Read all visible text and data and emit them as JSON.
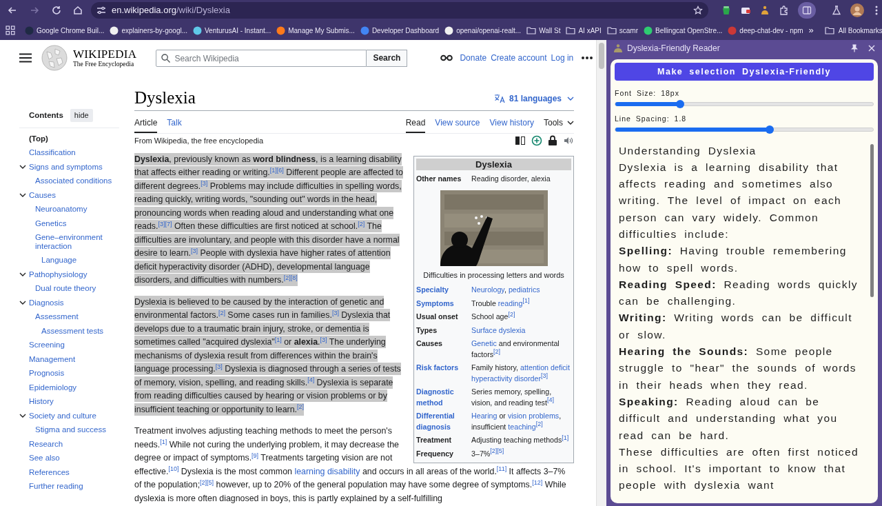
{
  "browser": {
    "address": {
      "host": "en.wikipedia.org",
      "path": "/wiki/Dyslexia"
    },
    "bookmarks": [
      {
        "label": "Google Chrome Buil...",
        "kind": "site",
        "color": "#1f2a44"
      },
      {
        "label": "explainers-by-googl...",
        "kind": "site",
        "color": "#f0f0f0"
      },
      {
        "label": "VenturusAI - Instant...",
        "kind": "site",
        "color": "#5fc8e8"
      },
      {
        "label": "Manage My Submis...",
        "kind": "site",
        "color": "#ff7a1a"
      },
      {
        "label": "Developer Dashboard",
        "kind": "site",
        "color": "#4285f4"
      },
      {
        "label": "openai/openai-realt...",
        "kind": "site",
        "color": "#f0f0f0"
      },
      {
        "label": "Wall St",
        "kind": "folder"
      },
      {
        "label": "AI xAPI",
        "kind": "folder"
      },
      {
        "label": "scamr",
        "kind": "folder"
      },
      {
        "label": "Bellingcat OpenStre...",
        "kind": "site",
        "color": "#2ecc71"
      },
      {
        "label": "deep-chat-dev - npm",
        "kind": "site",
        "color": "#cb3837"
      }
    ],
    "overflow": "»",
    "all_bookmarks": "All Bookmarks"
  },
  "wiki": {
    "logo": {
      "title": "WIKIPEDIA",
      "tagline": "The Free Encyclopedia"
    },
    "search": {
      "placeholder": "Search Wikipedia",
      "button": "Search"
    },
    "user_links": [
      "Donate",
      "Create account",
      "Log in"
    ],
    "toc": {
      "title": "Contents",
      "hide": "hide",
      "items": [
        {
          "label": "(Top)",
          "selected": true
        },
        {
          "label": "Classification",
          "selected": false
        },
        {
          "label": "Signs and symptoms",
          "selected": false,
          "expanded": true,
          "children": [
            {
              "label": "Associated conditions",
              "selected": false
            }
          ]
        },
        {
          "label": "Causes",
          "selected": false,
          "expanded": true,
          "children": [
            {
              "label": "Neuroanatomy",
              "selected": false
            },
            {
              "label": "Genetics",
              "selected": false
            },
            {
              "label": "Gene–environment interaction",
              "selected": false,
              "children": [
                {
                  "label": "Language",
                  "selected": false
                }
              ]
            }
          ]
        },
        {
          "label": "Pathophysiology",
          "selected": false,
          "expanded": true,
          "children": [
            {
              "label": "Dual route theory",
              "selected": false
            }
          ]
        },
        {
          "label": "Diagnosis",
          "selected": false,
          "expanded": true,
          "children": [
            {
              "label": "Assessment",
              "selected": false,
              "children": [
                {
                  "label": "Assessment tests",
                  "selected": false
                }
              ]
            }
          ]
        },
        {
          "label": "Screening",
          "selected": false
        },
        {
          "label": "Management",
          "selected": false
        },
        {
          "label": "Prognosis",
          "selected": false
        },
        {
          "label": "Epidemiology",
          "selected": false
        },
        {
          "label": "History",
          "selected": false
        },
        {
          "label": "Society and culture",
          "selected": false,
          "expanded": true,
          "children": [
            {
              "label": "Stigma and success",
              "selected": false
            }
          ]
        },
        {
          "label": "Research",
          "selected": false
        },
        {
          "label": "See also",
          "selected": false
        },
        {
          "label": "References",
          "selected": false
        },
        {
          "label": "Further reading",
          "selected": false
        }
      ]
    },
    "article": {
      "title": "Dyslexia",
      "languages": "81 languages",
      "tabs_left": [
        {
          "label": "Article",
          "selected": true
        },
        {
          "label": "Talk",
          "selected": false
        }
      ],
      "tabs_right": [
        {
          "label": "Read",
          "selected": true,
          "kind": "tab"
        },
        {
          "label": "View source",
          "selected": false,
          "kind": "tab"
        },
        {
          "label": "View history",
          "selected": false,
          "kind": "tab"
        },
        {
          "label": "Tools",
          "selected": false,
          "kind": "menu"
        }
      ],
      "tagline": "From Wikipedia, the free encyclopedia",
      "paragraphs": [
        {
          "selected": true,
          "segments": [
            {
              "text": "**Dyslexia**, previously known as **word blindness**, is a learning disability that affects either reading or writing.$^{[1][6]}$ Different people are affected to different degrees.$^{[3]}$ Problems may include difficulties in spelling words, reading quickly, writing words, \"sounding out\" words in the head, pronouncing words when reading aloud and understanding what one reads.$^{[3][7]}$ Often these difficulties are first noticed at school.$^{[2]}$ The difficulties are involuntary, and people with this disorder have a normal desire to learn.$^{[3]}$ People with dyslexia have higher rates of attention deficit hyperactivity disorder (ADHD), developmental language disorders, and difficulties with numbers.$^{[2][8]}$",
              "link": false
            }
          ]
        },
        {
          "selected": true,
          "segments": [
            {
              "text": "Dyslexia is believed to be caused by the interaction of genetic and environmental factors.$^{[2]}$ Some cases run in families.$^{[3]}$ Dyslexia that develops due to a traumatic brain injury, stroke, or dementia is sometimes called \"acquired dyslexia\"$^{[1]}$ or **alexia**.$^{[3]}$ The underlying mechanisms of dyslexia result from differences within the brain's language processing.$^{[3]}$ Dyslexia is diagnosed through a series of tests of memory, vision, spelling, and reading skills.$^{[4]}$ Dyslexia is separate from reading difficulties caused by hearing or vision problems or by insufficient teaching or opportunity to learn.$^{[2]}$",
              "link": false
            }
          ]
        },
        {
          "selected": false,
          "parts": [
            {
              "segments": [
                {
                  "text": "Treatment involves adjusting teaching methods to meet the person's needs.$^{[1]}$ While not curing the underlying problem, it may decrease the degree or impact of symptoms.$^{[9]}$ Treatments targeting vision are not",
                  "link": false
                }
              ]
            },
            {
              "segments": [
                {
                  "text": "effective.$^{[10]}$ Dyslexia is the most common ",
                  "link": false
                },
                {
                  "text": "learning disability",
                  "link": true
                },
                {
                  "text": " and occurs in all areas of the world.$^{[11]}$ It affects 3–7% of the population;$^{[2][5]}$ however, up to 20% of the general population may have some degree of symptoms.$^{[12]}$ While dyslexia is more often diagnosed in boys, this is partly explained by a self-fulfilling",
                  "link": false
                }
              ]
            }
          ]
        }
      ]
    },
    "infobox": {
      "title": "Dyslexia",
      "header_rows": [
        {
          "label": "Other names",
          "label_link": false,
          "value": [
            {
              "text": "Reading disorder, alexia",
              "link": false
            }
          ]
        }
      ],
      "image": {
        "kind": "picture",
        "caption": "Difficulties in processing letters and words"
      },
      "rows": [
        {
          "label": "Specialty",
          "label_link": true,
          "value": [
            {
              "text": "Neurology",
              "link": true
            },
            {
              "text": ", ",
              "link": false
            },
            {
              "text": "pediatrics",
              "link": true
            }
          ]
        },
        {
          "label": "Symptoms",
          "label_link": true,
          "value": [
            {
              "text": "Trouble ",
              "link": false
            },
            {
              "text": "reading$^{[1]}$",
              "link": true
            }
          ]
        },
        {
          "label": "Usual onset",
          "label_link": false,
          "value": [
            {
              "text": "School age$^{[2]}$",
              "link": false
            }
          ]
        },
        {
          "label": "Types",
          "label_link": false,
          "value": [
            {
              "text": "Surface dyslexia",
              "link": true
            }
          ]
        },
        {
          "label": "Causes",
          "label_link": false,
          "value": [
            {
              "text": "Genetic",
              "link": true
            },
            {
              "text": " and environmental factors$^{[2]}$",
              "link": false
            }
          ]
        },
        {
          "label": "Risk factors",
          "label_link": true,
          "value": [
            {
              "text": "Family history, ",
              "link": false
            },
            {
              "text": "attention deficit",
              "link": true
            },
            {
              "text": "hyperactivity disorder$^{[3]}$",
              "link": true
            }
          ]
        },
        {
          "label": "Diagnostic method",
          "label_link": true,
          "value": [
            {
              "text": "Series memory, spelling, vision, and reading test$^{[4]}$",
              "link": false
            }
          ]
        },
        {
          "label": "Differential diagnosis",
          "label_link": true,
          "value": [
            {
              "text": "Hearing",
              "link": true
            },
            {
              "text": " or ",
              "link": false
            },
            {
              "text": "vision problems",
              "link": true
            },
            {
              "text": ", insufficient ",
              "link": false
            },
            {
              "text": "teaching$^{[2]}$",
              "link": true
            }
          ]
        },
        {
          "label": "Treatment",
          "label_link": false,
          "value": [
            {
              "text": "Adjusting teaching methods$^{[1]}$",
              "link": false
            }
          ]
        },
        {
          "label": "Frequency",
          "label_link": false,
          "value": [
            {
              "text": "3–7%$^{[2][5]}$",
              "link": false
            }
          ]
        }
      ]
    }
  },
  "panel": {
    "title": "Dyslexia-Friendly Reader",
    "button": "Make selection Dyslexia-Friendly",
    "sliders": [
      {
        "label": "Font Size: 18px",
        "level": 0.25
      },
      {
        "label": "Line Spacing: 1.8",
        "level": 0.6
      }
    ],
    "content": [
      "Understanding Dyslexia",
      "Dyslexia is a learning disability that affects reading and sometimes also writing. The level of impact on each person can vary widely. Common difficulties include:",
      "**Spelling:** Having trouble remembering how to spell words.",
      "**Reading Speed:** Reading words quickly can be challenging.",
      "**Writing:** Writing words can be difficult or slow.",
      "**Hearing the Sounds:** Some people struggle to \"hear\" the sounds of words in their heads when they read.",
      "**Speaking:** Reading aloud can be difficult and understanding what you read can be hard.",
      "These difficulties are often first noticed in school. It's important to know that people with dyslexia want"
    ]
  }
}
